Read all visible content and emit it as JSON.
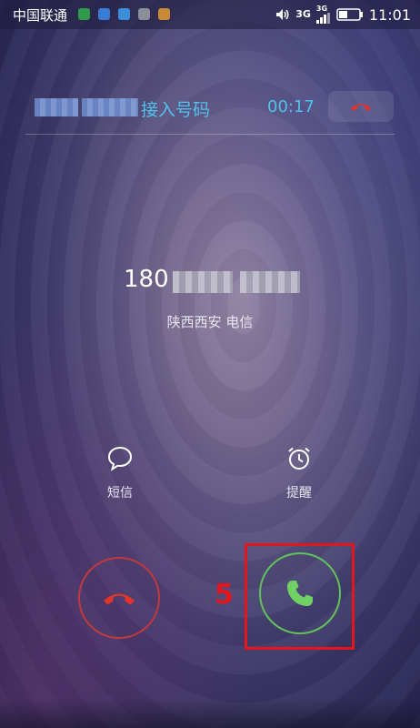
{
  "status_bar": {
    "carrier": "中国联通",
    "network_type_1": "3G",
    "network_type_2": "3G",
    "time": "11:01",
    "notification_icons": [
      "phone-icon",
      "medical-icon",
      "message-icon",
      "photo-icon",
      "contacts-icon"
    ]
  },
  "call_waiting": {
    "label": "接入号码",
    "duration": "00:17",
    "end_icon": "hang-up-icon"
  },
  "caller": {
    "number_prefix": "180",
    "location": "陕西西安 电信"
  },
  "actions": [
    {
      "label": "短信",
      "icon": "message-bubble-icon"
    },
    {
      "label": "提醒",
      "icon": "alarm-clock-icon"
    }
  ],
  "buttons": {
    "decline_icon": "hang-up-icon",
    "answer_icon": "phone-icon"
  },
  "annotation": {
    "step_number": "5"
  },
  "colors": {
    "accent": "#4fc2ec",
    "decline": "#c0393f",
    "answer": "#5fc35a",
    "annotation": "#e3161e"
  }
}
